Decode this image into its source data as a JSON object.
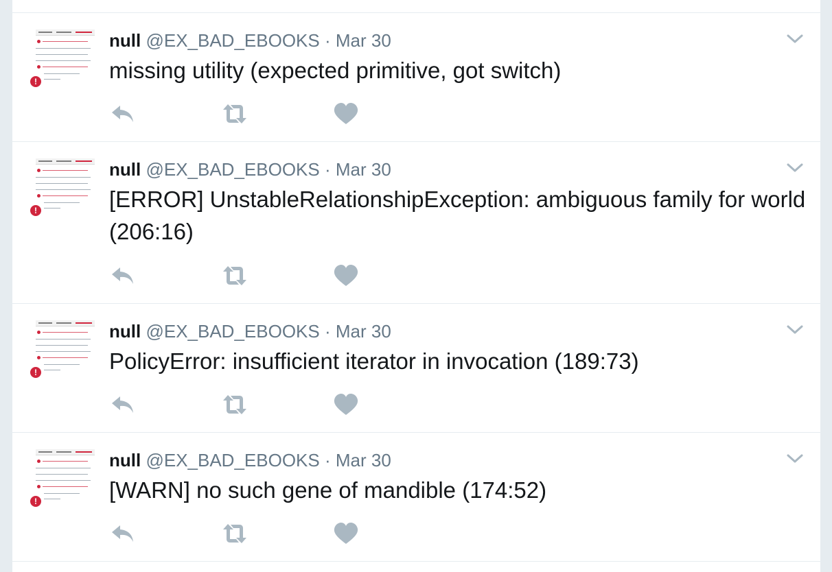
{
  "tweets": [
    {
      "name": "null",
      "handle": "@EX_BAD_EBOOKS",
      "separator": "·",
      "time": "Mar 30",
      "text": "missing utility (expected primitive, got switch)"
    },
    {
      "name": "null",
      "handle": "@EX_BAD_EBOOKS",
      "separator": "·",
      "time": "Mar 30",
      "text": "[ERROR] UnstableRelationshipException: ambiguous family for world (206:16)"
    },
    {
      "name": "null",
      "handle": "@EX_BAD_EBOOKS",
      "separator": "·",
      "time": "Mar 30",
      "text": "PolicyError: insufficient iterator in invocation (189:73)"
    },
    {
      "name": "null",
      "handle": "@EX_BAD_EBOOKS",
      "separator": "·",
      "time": "Mar 30",
      "text": "[WARN] no such gene of mandible (174:52)"
    }
  ],
  "actions": {
    "reply_icon": "reply-icon",
    "retweet_icon": "retweet-icon",
    "like_icon": "heart-icon",
    "more_icon": "chevron-down-icon"
  },
  "colors": {
    "icon": "#aab8c2",
    "text": "#14171a",
    "muted": "#657786",
    "border": "#e6ecf0",
    "avatar_error": "#d0253d"
  }
}
